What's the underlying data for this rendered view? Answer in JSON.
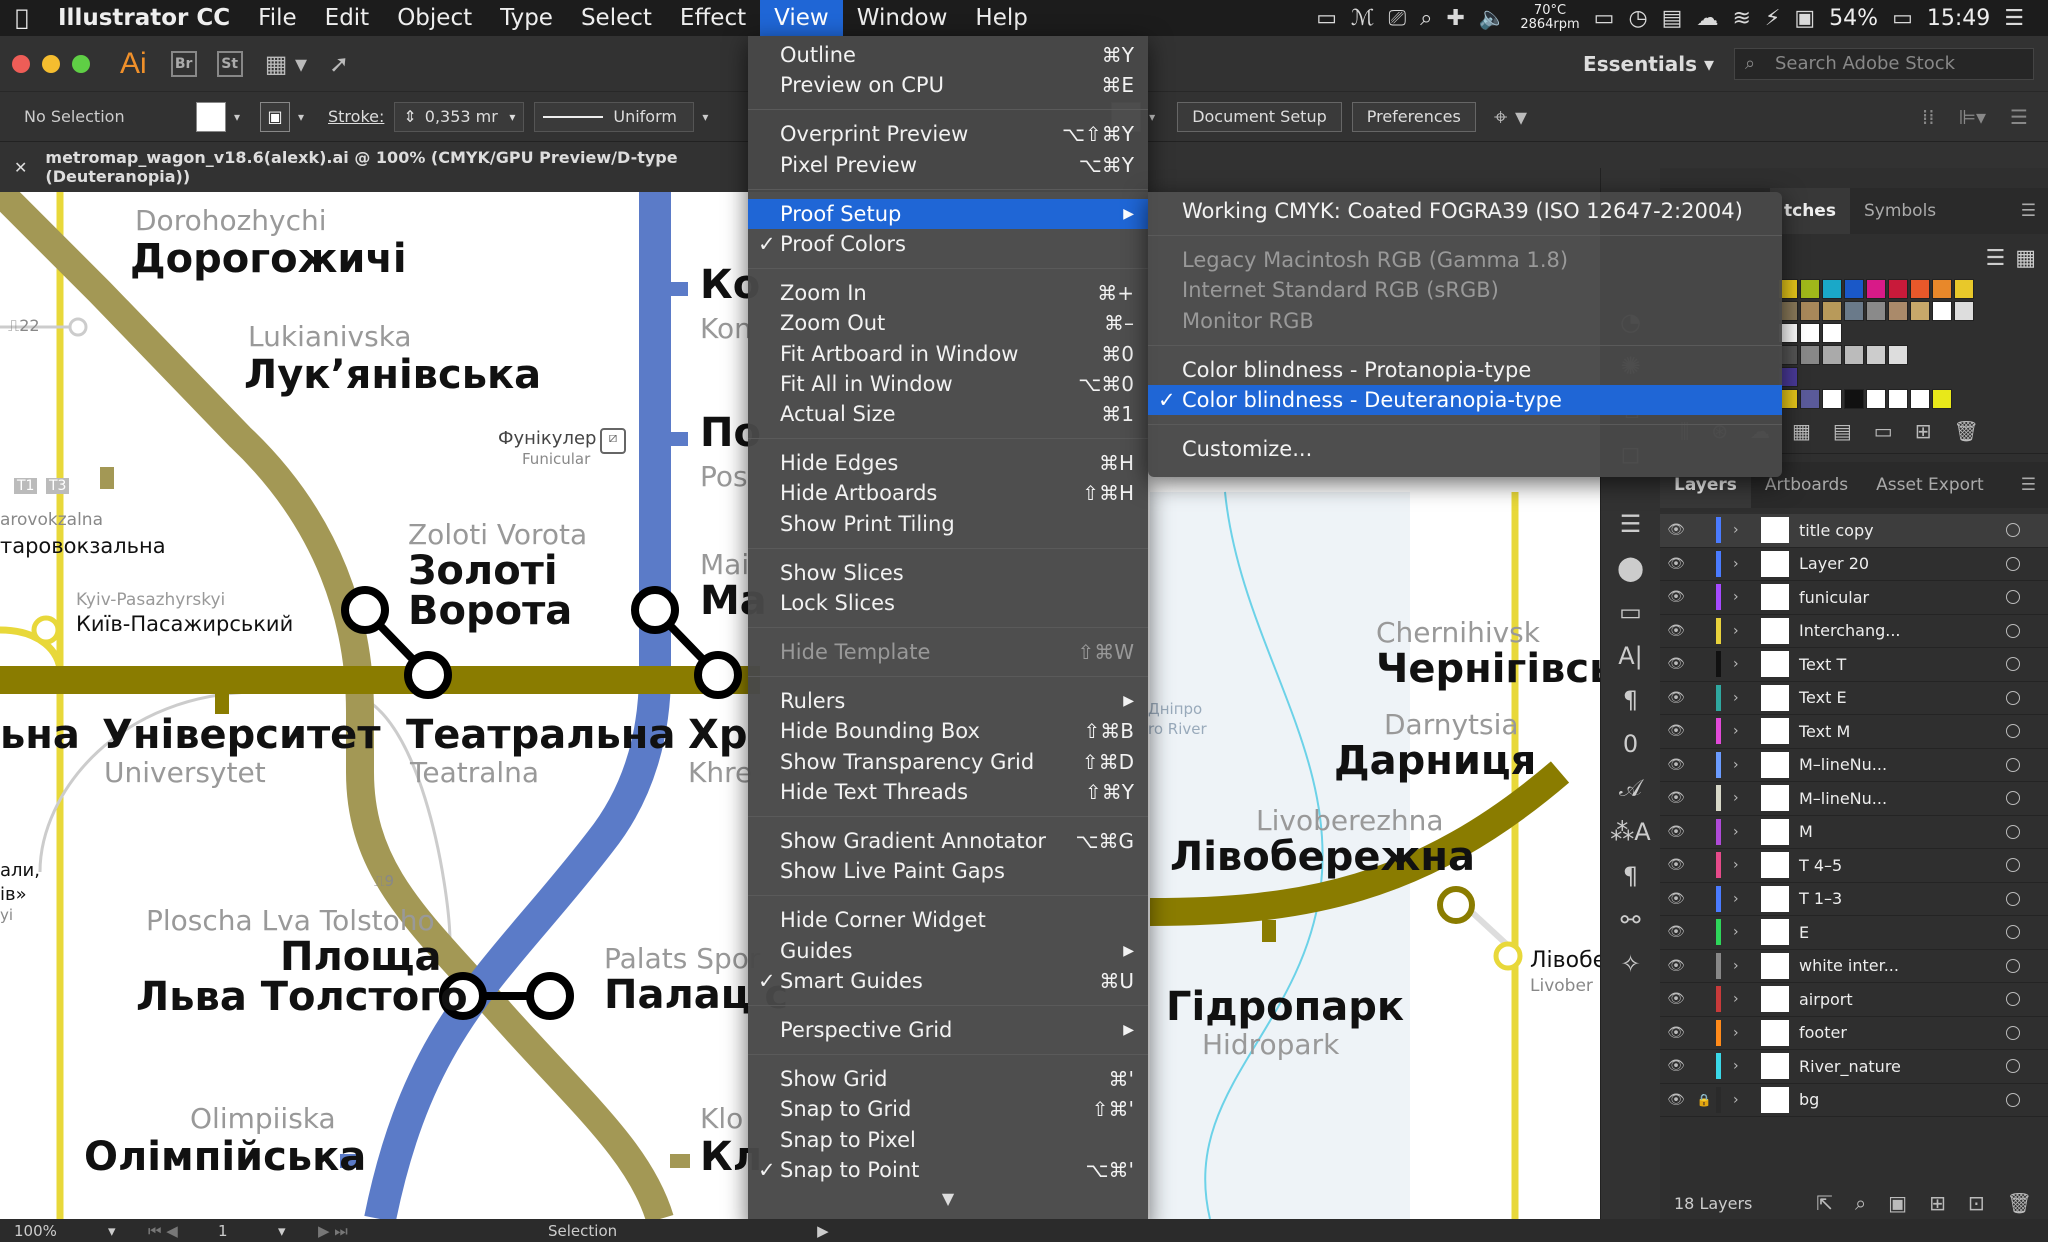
{
  "menubar": {
    "app": "Illustrator CC",
    "items": [
      "File",
      "Edit",
      "Object",
      "Type",
      "Select",
      "Effect",
      "View",
      "Window",
      "Help"
    ],
    "temp": "70°C",
    "rpm": "2864rpm",
    "battery": "54%",
    "time": "15:49"
  },
  "appbar": {
    "logo": "Ai",
    "bridge": "Br",
    "stock": "St",
    "workspace": "Essentials",
    "search_placeholder": "Search Adobe Stock"
  },
  "control": {
    "selection": "No Selection",
    "stroke_label": "Stroke:",
    "stroke_value": "0,353 mr",
    "profile": "Uniform",
    "doc_setup": "Document Setup",
    "preferences": "Preferences"
  },
  "doc": {
    "tab_title": "metromap_wagon_v18.6(alexk).ai @ 100% (CMYK/GPU Preview/D-type (Deuteranopia))"
  },
  "view_menu": {
    "items": [
      {
        "label": "Outline",
        "shortcut": "⌘Y"
      },
      {
        "label": "Preview on CPU",
        "shortcut": "⌘E"
      },
      {
        "sep": true
      },
      {
        "label": "Overprint Preview",
        "shortcut": "⌥⇧⌘Y"
      },
      {
        "label": "Pixel Preview",
        "shortcut": "⌥⌘Y"
      },
      {
        "sep": true
      },
      {
        "label": "Proof Setup",
        "shortcut": "",
        "submenu": true,
        "highlight": true
      },
      {
        "label": "Proof Colors",
        "shortcut": "",
        "checked": true
      },
      {
        "sep": true
      },
      {
        "label": "Zoom In",
        "shortcut": "⌘+"
      },
      {
        "label": "Zoom Out",
        "shortcut": "⌘–"
      },
      {
        "label": "Fit Artboard in Window",
        "shortcut": "⌘0"
      },
      {
        "label": "Fit All in Window",
        "shortcut": "⌥⌘0"
      },
      {
        "label": "Actual Size",
        "shortcut": "⌘1"
      },
      {
        "sep": true
      },
      {
        "label": "Hide Edges",
        "shortcut": "⌘H"
      },
      {
        "label": "Hide Artboards",
        "shortcut": "⇧⌘H"
      },
      {
        "label": "Show Print Tiling",
        "shortcut": ""
      },
      {
        "sep": true
      },
      {
        "label": "Show Slices",
        "shortcut": ""
      },
      {
        "label": "Lock Slices",
        "shortcut": ""
      },
      {
        "sep": true
      },
      {
        "label": "Hide Template",
        "shortcut": "⇧⌘W",
        "disabled": true
      },
      {
        "sep": true
      },
      {
        "label": "Rulers",
        "shortcut": "",
        "submenu": true
      },
      {
        "label": "Hide Bounding Box",
        "shortcut": "⇧⌘B"
      },
      {
        "label": "Show Transparency Grid",
        "shortcut": "⇧⌘D"
      },
      {
        "label": "Hide Text Threads",
        "shortcut": "⇧⌘Y"
      },
      {
        "sep": true
      },
      {
        "label": "Show Gradient Annotator",
        "shortcut": "⌥⌘G"
      },
      {
        "label": "Show Live Paint Gaps",
        "shortcut": ""
      },
      {
        "sep": true
      },
      {
        "label": "Hide Corner Widget",
        "shortcut": ""
      },
      {
        "label": "Guides",
        "shortcut": "",
        "submenu": true
      },
      {
        "label": "Smart Guides",
        "shortcut": "⌘U",
        "checked": true
      },
      {
        "sep": true
      },
      {
        "label": "Perspective Grid",
        "shortcut": "",
        "submenu": true
      },
      {
        "sep": true
      },
      {
        "label": "Show Grid",
        "shortcut": "⌘'"
      },
      {
        "label": "Snap to Grid",
        "shortcut": "⇧⌘'"
      },
      {
        "label": "Snap to Pixel",
        "shortcut": ""
      },
      {
        "label": "Snap to Point",
        "shortcut": "⌥⌘'",
        "checked": true
      }
    ]
  },
  "proof_submenu": {
    "items": [
      {
        "label": "Working CMYK: Coated FOGRA39 (ISO 12647-2:2004)"
      },
      {
        "sep": true
      },
      {
        "label": "Legacy Macintosh RGB (Gamma 1.8)",
        "disabled": true
      },
      {
        "label": "Internet Standard RGB (sRGB)",
        "disabled": true
      },
      {
        "label": "Monitor RGB",
        "disabled": true
      },
      {
        "sep": true
      },
      {
        "label": "Color blindness - Protanopia-type"
      },
      {
        "label": "Color blindness - Deuteranopia-type",
        "checked": true,
        "highlight": true
      },
      {
        "sep": true
      },
      {
        "label": "Customize..."
      }
    ]
  },
  "map_labels": {
    "dorohozhychi_lat": "Dorohozhychi",
    "dorohozhychi_ukr": "Дорогожичі",
    "lukianivska_lat": "Lukianivska",
    "lukianivska_ukr": "Лук’янівська",
    "funicular_ukr": "Фунікулер",
    "funicular_lat": "Funicular",
    "zoloti_lat": "Zoloti Vorota",
    "zoloti_ukr1": "Золоті",
    "zoloti_ukr2": "Ворота",
    "kyivpas_lat": "Kyiv-Pasazhyrskyi",
    "kyivpas_ukr": "Київ-Пасажирський",
    "vokzalna_lat": "arovokzalna",
    "vokzalna_ukr": "таровокзальна",
    "univ_ukr": "Університет",
    "univ_lat": "Universytet",
    "teatr_ukr": "Театральна",
    "teatr_lat": "Teatralna",
    "khre_ukr": "Хр",
    "khre_lat": "Khre",
    "tolstoho_lat": "Ploscha Lva Tolstoho",
    "tolstoho_ukr1": "Площа",
    "tolstoho_ukr2": "Льва Толстого",
    "palats_lat": "Palats Spor",
    "palats_ukr": "Палац с",
    "olimp_lat": "Olimpiiska",
    "olimp_ukr": "Олімпійська",
    "klo_lat": "Klo",
    "klo_ukr": "Кл",
    "ko_ukr": "Ко",
    "ko_lat": "Kon",
    "po_ukr": "По",
    "po_lat": "Pos",
    "mai_lat": "Mai",
    "mai_ukr": "Ма",
    "chern_lat": "Chernihivsk",
    "chern_ukr": "Чернігівськ",
    "darn_lat": "Darnytsia",
    "darn_ukr": "Дарниця",
    "livo_lat": "Livoberezhna",
    "livo_ukr": "Лівобережна",
    "hidro_ukr": "Гідропарк",
    "hidro_lat": "Hidropark",
    "livobe_ukr": "Лівобе",
    "livobe_lat": "Livober",
    "dnipro1": "Дніпро",
    "dnipro2": "ro River",
    "bus22": "22",
    "bus9": "9",
    "t1": "T1",
    "t3": "T3",
    "ali": "али,",
    "iv": "ів»",
    "yi": "yi",
    "ha": "ьна"
  },
  "panels": {
    "swatch_tabs": [
      "tches",
      "Symbols"
    ],
    "layer_tabs": [
      "Layers",
      "Artboards",
      "Asset Export"
    ],
    "layers": [
      {
        "name": "title copy",
        "color": "#4a7bff",
        "selected": true
      },
      {
        "name": "Layer 20",
        "color": "#4a7bff"
      },
      {
        "name": "funicular",
        "color": "#a64aff"
      },
      {
        "name": "Interchang...",
        "color": "#e8d23c"
      },
      {
        "name": "Text T",
        "color": "#111111"
      },
      {
        "name": "Text E",
        "color": "#2fa8a0"
      },
      {
        "name": "Text M",
        "color": "#e24ad8"
      },
      {
        "name": "M–lineNu...",
        "color": "#6b9cff"
      },
      {
        "name": "M–lineNu...",
        "color": "#d8d8c8"
      },
      {
        "name": "M",
        "color": "#b04ad8"
      },
      {
        "name": "T 4–5",
        "color": "#e64a8a"
      },
      {
        "name": "T 1–3",
        "color": "#4a7bff"
      },
      {
        "name": "E",
        "color": "#2ed65a"
      },
      {
        "name": "white inter...",
        "color": "#888888"
      },
      {
        "name": "airport",
        "color": "#c83a3a"
      },
      {
        "name": "footer",
        "color": "#ff8a1a"
      },
      {
        "name": "River_nature",
        "color": "#3ad8e8"
      },
      {
        "name": "bg",
        "color": "#2a2a2a"
      }
    ],
    "layer_count": "18 Layers"
  },
  "status": {
    "zoom": "100%",
    "artboard": "1",
    "tool": "Selection"
  }
}
